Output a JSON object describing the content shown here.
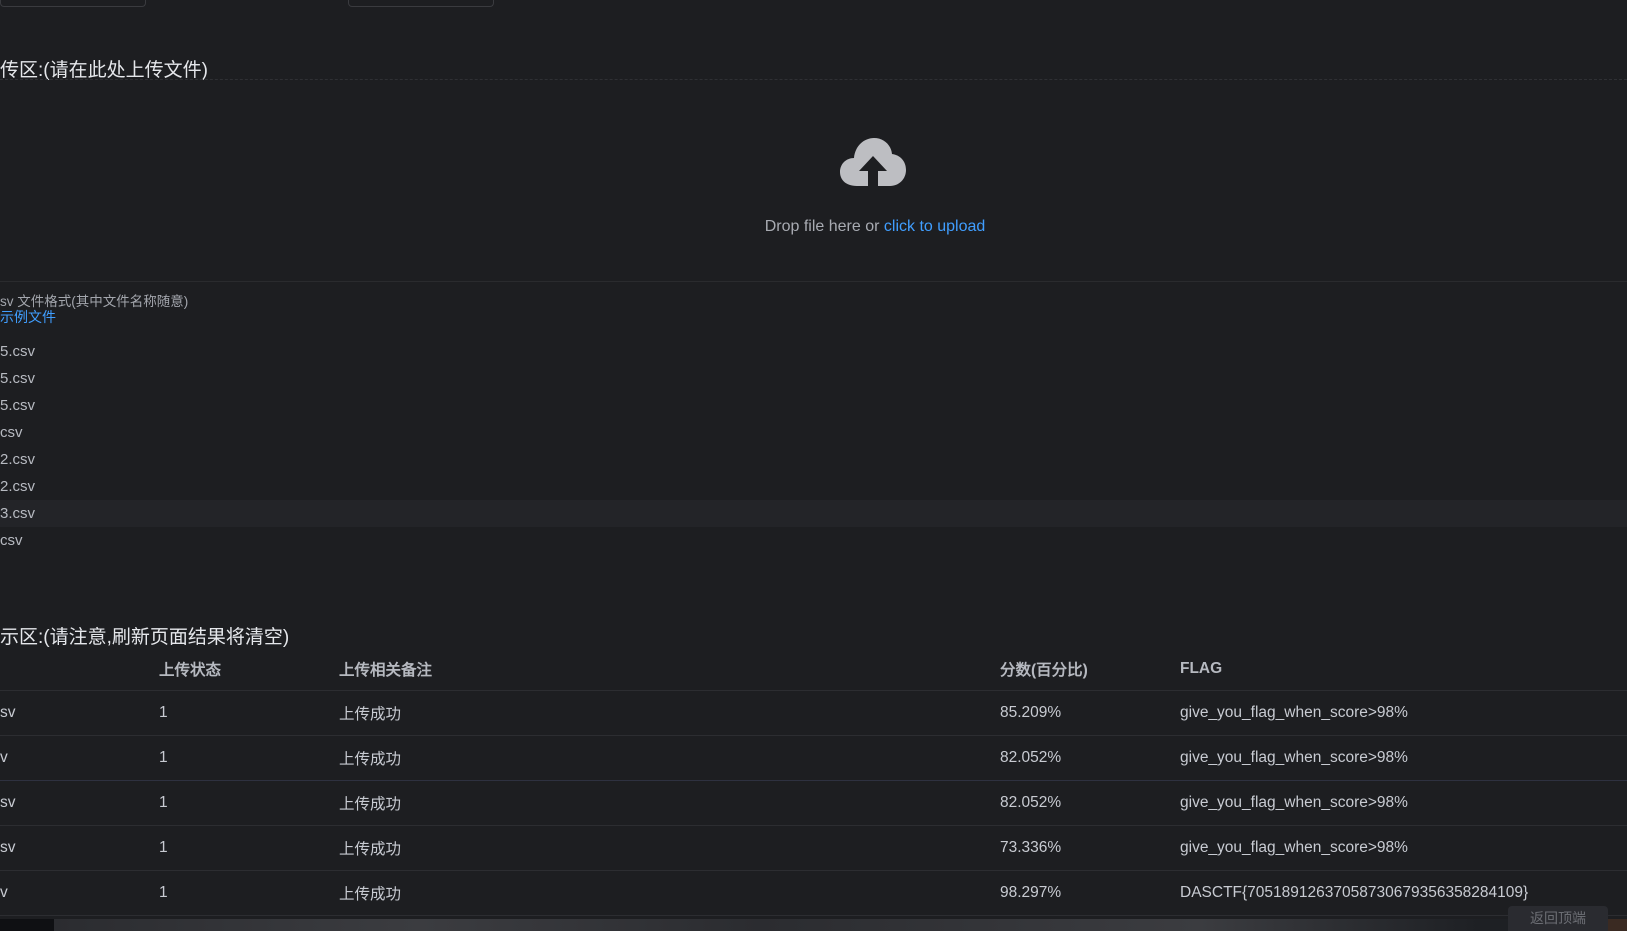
{
  "upload_section": {
    "title": "传区:(请在此处上传文件)",
    "drop_text": "Drop file here or",
    "click_text": "click to upload",
    "icon": "cloud-upload-icon"
  },
  "tip": {
    "format_text": "sv 文件格式(其中文件名称随意)",
    "sample_link": "示例文件"
  },
  "files": [
    "5.csv",
    "5.csv",
    "5.csv",
    "csv",
    "2.csv",
    "2.csv",
    "3.csv",
    "csv"
  ],
  "results": {
    "title": "示区:(请注意,刷新页面结果将清空)",
    "headers": [
      "",
      "上传状态",
      "上传相关备注",
      "分数(百分比)",
      "FLAG"
    ],
    "rows": [
      [
        "sv",
        "1",
        "上传成功",
        "85.209%",
        "give_you_flag_when_score>98%"
      ],
      [
        "v",
        "1",
        "上传成功",
        "82.052%",
        "give_you_flag_when_score>98%"
      ],
      [
        "sv",
        "1",
        "上传成功",
        "82.052%",
        "give_you_flag_when_score>98%"
      ],
      [
        "sv",
        "1",
        "上传成功",
        "73.336%",
        "give_you_flag_when_score>98%"
      ],
      [
        "v",
        "1",
        "上传成功",
        "98.297%",
        "DASCTF{70518912637058730679356358284109}"
      ]
    ]
  },
  "back_to_top": "返回顶端",
  "colors": {
    "background": "#1d1e21",
    "link": "#409eff"
  }
}
